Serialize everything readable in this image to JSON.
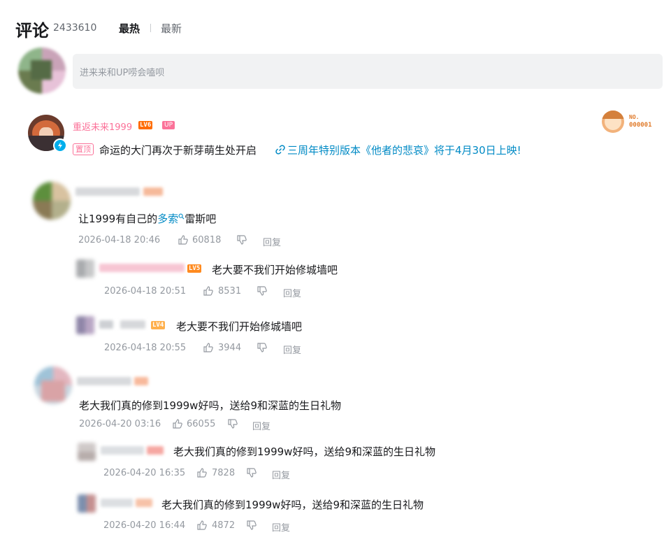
{
  "header": {
    "title": "评论",
    "count": "2433610",
    "sort_hot": "最热",
    "sort_new": "最新"
  },
  "input": {
    "placeholder": "进来来和UP唠会嗑呗"
  },
  "pinned": {
    "username": "重返未来1999",
    "level": "LV6",
    "up_badge": "UP",
    "pin_tag": "置顶",
    "text": "命运的大门再次于新芽萌生处开启",
    "link_text": "三周年特别版本《他者的悲哀》将于4月30日上映!",
    "medal_no": "NO.",
    "medal_code": "000001"
  },
  "comments": [
    {
      "text_prefix": "让1999有自己的",
      "keyword": "多索",
      "text_suffix": "雷斯吧",
      "time": "2026-04-18 20:46",
      "likes": "60818",
      "reply_label": "回复",
      "replies": [
        {
          "level": "LV5",
          "text": "老大要不我们开始修城墙吧",
          "time": "2026-04-18 20:51",
          "likes": "8531",
          "reply_label": "回复"
        },
        {
          "level": "LV4",
          "text": "老大要不我们开始修城墙吧",
          "time": "2026-04-18 20:55",
          "likes": "3944",
          "reply_label": "回复"
        }
      ]
    },
    {
      "text": "老大我们真的修到1999w好吗，送给9和深蓝的生日礼物",
      "time": "2026-04-20 03:16",
      "likes": "66055",
      "reply_label": "回复",
      "replies": [
        {
          "text": "老大我们真的修到1999w好吗，送给9和深蓝的生日礼物",
          "time": "2026-04-20 16:35",
          "likes": "7828",
          "reply_label": "回复"
        },
        {
          "text": "老大我们真的修到1999w好吗，送给9和深蓝的生日礼物",
          "time": "2026-04-20 16:44",
          "likes": "4872",
          "reply_label": "回复"
        }
      ]
    }
  ],
  "colors": {
    "up_name": "#fb7299",
    "link": "#008ac5",
    "muted": "#9499a0"
  },
  "icons": [
    "like-icon",
    "dislike-icon",
    "link-icon",
    "search-icon",
    "verified-icon"
  ]
}
